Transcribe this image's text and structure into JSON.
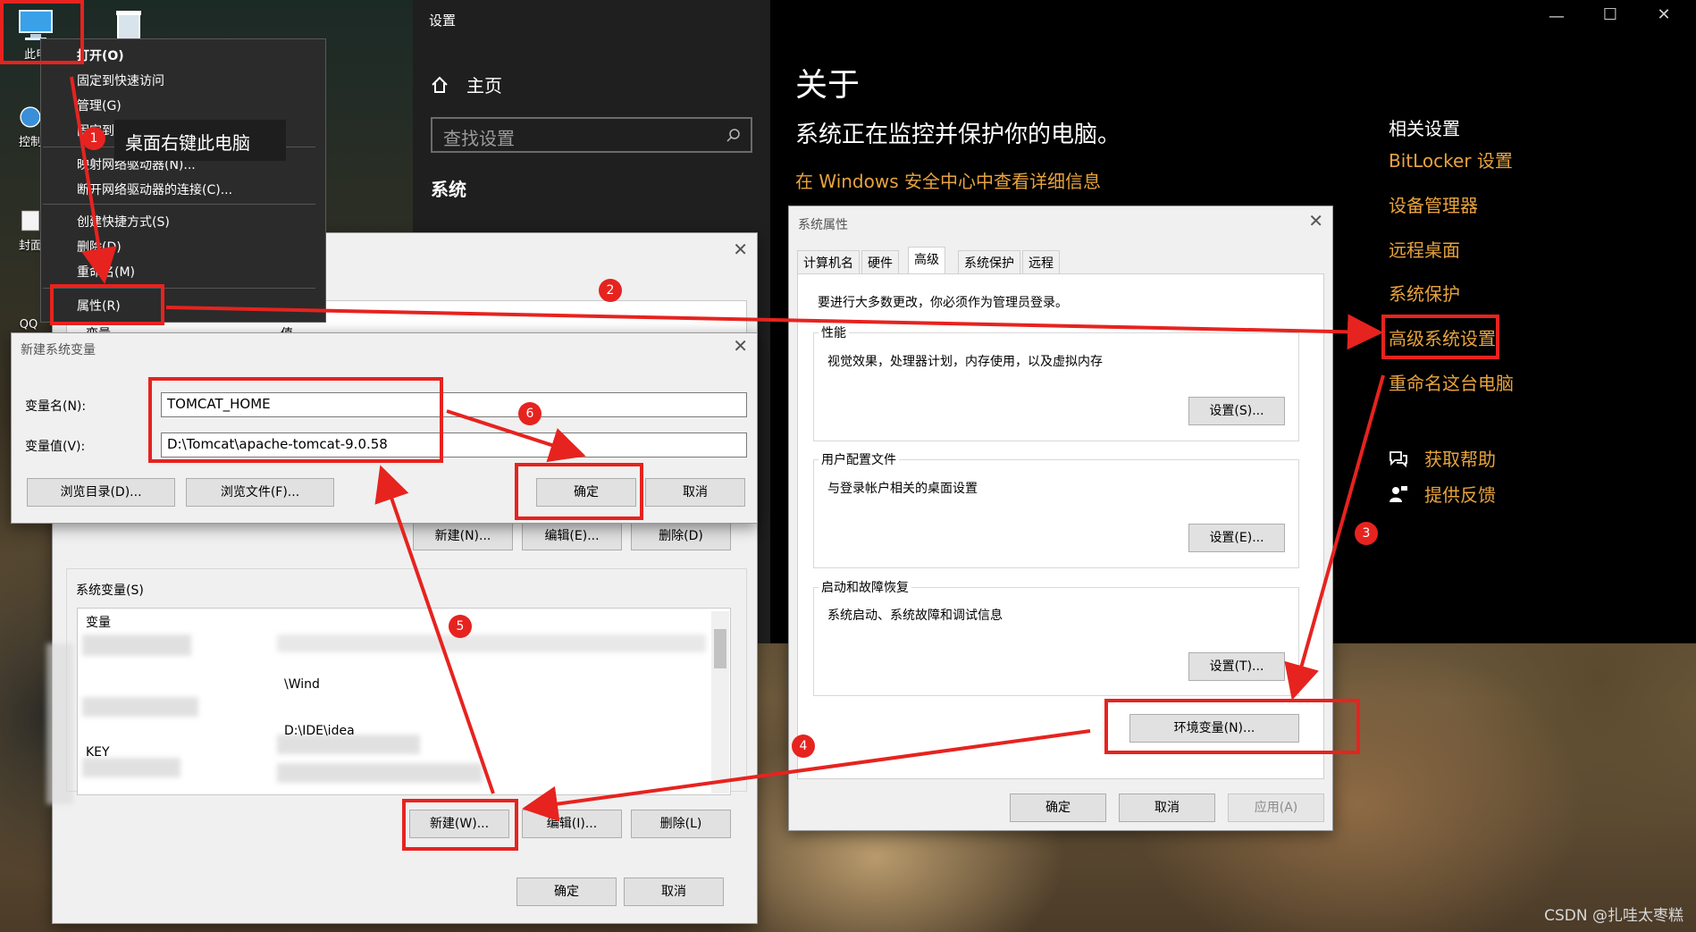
{
  "desktop": {
    "icons": [
      {
        "label": "此电"
      },
      {
        "label": "控制"
      },
      {
        "label": "封面"
      },
      {
        "label": "QQ"
      }
    ]
  },
  "settings": {
    "window_title": "设置",
    "nav_home": "主页",
    "search_placeholder": "查找设置",
    "section_system": "系统",
    "about_title": "关于",
    "about_subtitle": "系统正在监控并保护你的电脑。",
    "security_link": "在 Windows 安全中心中查看详细信息",
    "related_title": "相关设置",
    "related_links": [
      "BitLocker 设置",
      "设备管理器",
      "远程桌面",
      "系统保护",
      "高级系统设置",
      "重命名这台电脑"
    ],
    "help_link": "获取帮助",
    "feedback_link": "提供反馈",
    "accent_color": "#e8a33d"
  },
  "context_menu": {
    "items": [
      "打开(O)",
      "固定到快速访问",
      "管理(G)",
      "固定到\"开始\"屏幕(P)",
      "映射网络驱动器(N)...",
      "断开网络驱动器的连接(C)...",
      "创建快捷方式(S)",
      "删除(D)",
      "重命名(M)",
      "属性(R)"
    ]
  },
  "tooltip": "桌面右键此电脑",
  "system_properties": {
    "title": "系统属性",
    "tabs": [
      "计算机名",
      "硬件",
      "高级",
      "系统保护",
      "远程"
    ],
    "active_tab": "高级",
    "admin_note": "要进行大多数更改，你必须作为管理员登录。",
    "performance": {
      "label": "性能",
      "desc": "视觉效果，处理器计划，内存使用，以及虚拟内存",
      "button": "设置(S)..."
    },
    "user_profiles": {
      "label": "用户配置文件",
      "desc": "与登录帐户相关的桌面设置",
      "button": "设置(E)..."
    },
    "startup_recovery": {
      "label": "启动和故障恢复",
      "desc": "系统启动、系统故障和调试信息",
      "button": "设置(T)..."
    },
    "env_button": "环境变量(N)...",
    "ok": "确定",
    "cancel": "取消",
    "apply": "应用(A)"
  },
  "env_dialog": {
    "user_header_name": "变量",
    "user_header_value": "值",
    "user_new": "新建(N)...",
    "user_edit": "编辑(E)...",
    "user_delete": "删除(D)",
    "system_vars_label": "系统变量(S)",
    "system_header_name": "变量",
    "system_rows": [
      {
        "name": "",
        "value": "\\Wind"
      },
      {
        "name": "",
        "value": "D:\\IDE\\idea"
      },
      {
        "name": "KEY",
        "value": ""
      }
    ],
    "system_new": "新建(W)...",
    "system_edit": "编辑(I)...",
    "system_delete": "删除(L)",
    "ok": "确定",
    "cancel": "取消"
  },
  "new_var_dialog": {
    "title": "新建系统变量",
    "name_label": "变量名(N):",
    "name_value": "TOMCAT_HOME",
    "value_label": "变量值(V):",
    "value_value": "D:\\Tomcat\\apache-tomcat-9.0.58",
    "browse_dir": "浏览目录(D)...",
    "browse_file": "浏览文件(F)...",
    "ok": "确定",
    "cancel": "取消"
  },
  "annotations": {
    "steps": [
      "1",
      "2",
      "3",
      "4",
      "5",
      "6"
    ],
    "color": "#e6231f"
  },
  "watermark": "CSDN @扎哇太枣糕"
}
